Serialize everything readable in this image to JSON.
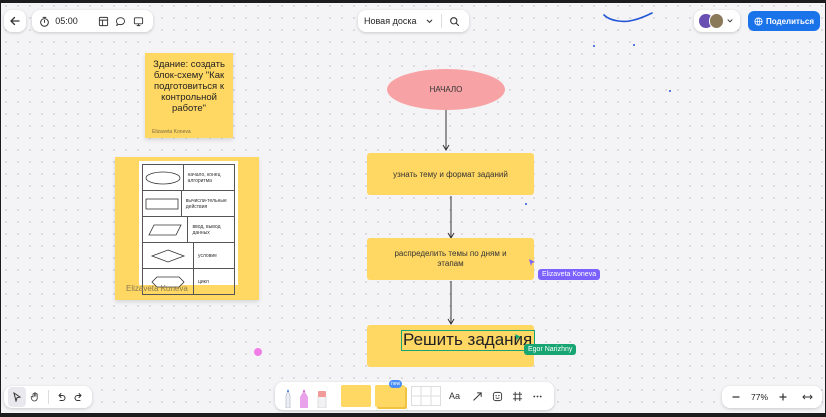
{
  "toolbar_top": {
    "timer": "05:00",
    "board_title": "Новая доска",
    "share_label": "Поделиться"
  },
  "stickies": {
    "task_text": "Здание: создать блок-схему \"Как подготовиться к контрольной работе\"",
    "task_author": "Elizaveta Koneva",
    "legend_author": "Elizaveta Koneva"
  },
  "legend": {
    "rows": [
      "начало, конец алгоритма",
      "вычисли-тельные действия",
      "ввод, вывод данных",
      "условие",
      "цикл"
    ]
  },
  "flowchart": {
    "start": "НАЧАЛО",
    "step1": "узнать тему и формат заданий",
    "step2": "распределить темы по дням и этапам",
    "step3": "Решить задания"
  },
  "cursors": {
    "user1": "Elizaveta Koneva",
    "user2": "Egor Narizhny"
  },
  "toolbar_bottom": {
    "new_badge": "new",
    "text_tool": "Aa"
  },
  "zoom": {
    "level": "77%"
  },
  "colors": {
    "sticky": "#ffd763",
    "start_oval": "#f7a3a5",
    "share_button": "#1a73e8",
    "cursor_purple": "#7b61ff",
    "cursor_green": "#17a673"
  }
}
